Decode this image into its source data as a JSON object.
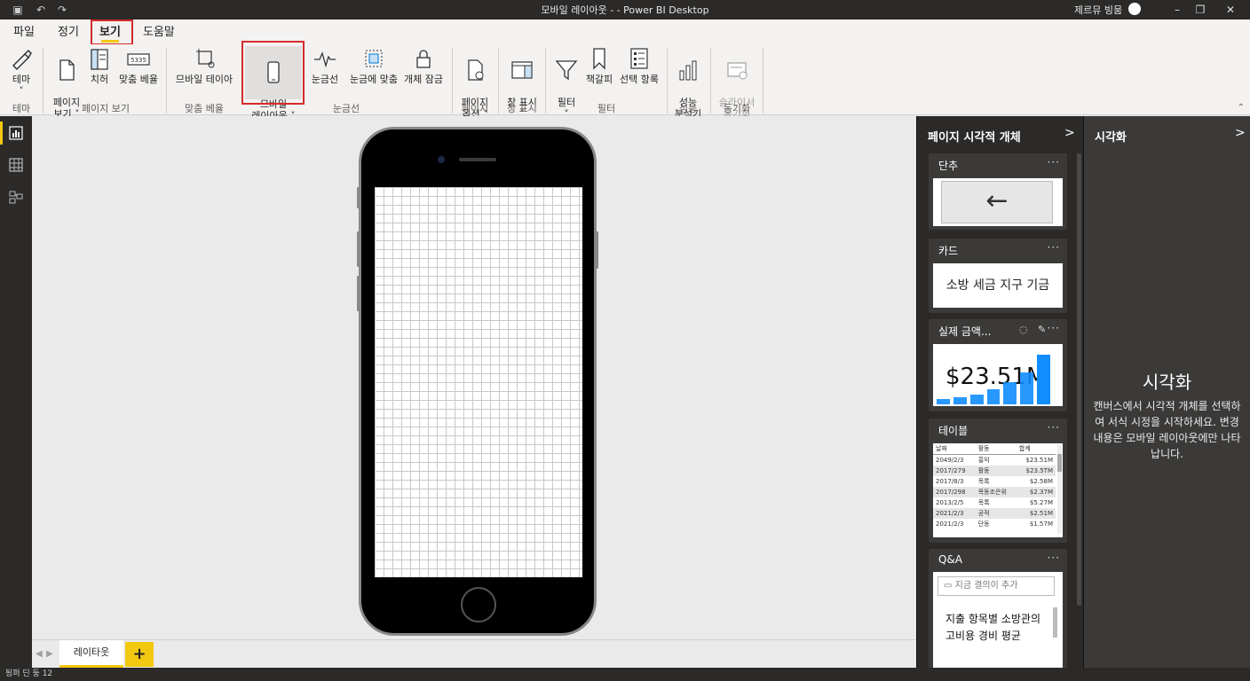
{
  "titlebar": {
    "title": "모바일 레이아웃 - - Power BI Desktop",
    "user": "제르뮤 빙뭄",
    "window_buttons": [
      "–",
      "❐",
      "✕"
    ]
  },
  "menu": {
    "tabs": [
      "파일",
      "정기",
      "보기",
      "도움말"
    ],
    "active": "보기"
  },
  "ribbon": {
    "buttons": {
      "theme": "테마",
      "page_view": "페이지\n보기 ˅",
      "snap": "치허",
      "fit_ratio": "맞춤 베율",
      "mobile_table": "므바일 테이아",
      "mobile_layout": "므바일\n레이아웃 ˅",
      "gridlines": "눈금선",
      "snap_to_grid": "눈금에 맞춤",
      "lock_objects": "개체 잠금",
      "page_options": "페이지\n옵션 ˅",
      "show_panes": "창 표시\n˅",
      "filters": "필터\n˅",
      "bookmarks": "책갈피",
      "selection": "선택 항록",
      "performance": "성능\n분석기",
      "sync_slicers": "슬라이서\n동기회"
    },
    "groups": {
      "theme": "테마",
      "page_view": "페이지 보기",
      "fit": "맞춤 베율",
      "gridlines": "눈금선",
      "page": "페이지",
      "show": "창 표시",
      "filter": "필터",
      "perf": "성능",
      "sync": "동기화"
    }
  },
  "pagetabs": {
    "tab": "레이타웃",
    "add": "+",
    "nav_prev": "◀",
    "nav_next": "▶"
  },
  "statusbar": {
    "text": "됭퍼 딘 둥 12"
  },
  "vispane": {
    "title": "페이지 시각적 개체",
    "chevron": ">",
    "cards": {
      "button": {
        "title": "단추",
        "dots": "···",
        "arrow": "←"
      },
      "card": {
        "title": "카드",
        "dots": "···",
        "value": "소방 세금 지구 기금"
      },
      "kpi": {
        "title": "실제 금액...",
        "dots": "···",
        "value": "$23.51M"
      },
      "table": {
        "title": "테이블",
        "dots": "···",
        "headers": [
          "날짜",
          "활동",
          "합계"
        ],
        "rows": [
          [
            "2049/2/3",
            "홍익",
            "$23.51M"
          ],
          [
            "2017/279",
            "활동",
            "$23.5TM"
          ],
          [
            "2017/8/3",
            "목록",
            "$2.58M"
          ],
          [
            "2017/298",
            "목동조은위",
            "$2.37M"
          ],
          [
            "2013/2/5",
            "목록",
            "$5.27M"
          ],
          [
            "2021/2/3",
            "공적",
            "$2.51M"
          ],
          [
            "2021/2/3",
            "단동",
            "$1.57M"
          ]
        ]
      },
      "qna": {
        "title": "Q&A",
        "dots": "···",
        "placeholder": "지금 결의이 추가",
        "answer": "지출 항목별 소방관의 고비용 경비 평균"
      }
    }
  },
  "fmtpane": {
    "title": "시각화",
    "chevron": ">",
    "heading": "시각화",
    "description": "캔버스에서 시각적 개체를 선택하여 서식 시정을 시작하세요. 변경 내용은 모바일 레이아웃에만 나타납니다."
  },
  "colors": {
    "accent": "#f2c811",
    "highlight": "#d62b2b",
    "bar_blue": "#118dff"
  },
  "kpi_bars": [
    0.1,
    0.15,
    0.2,
    0.3,
    0.45,
    0.65,
    1.0
  ]
}
